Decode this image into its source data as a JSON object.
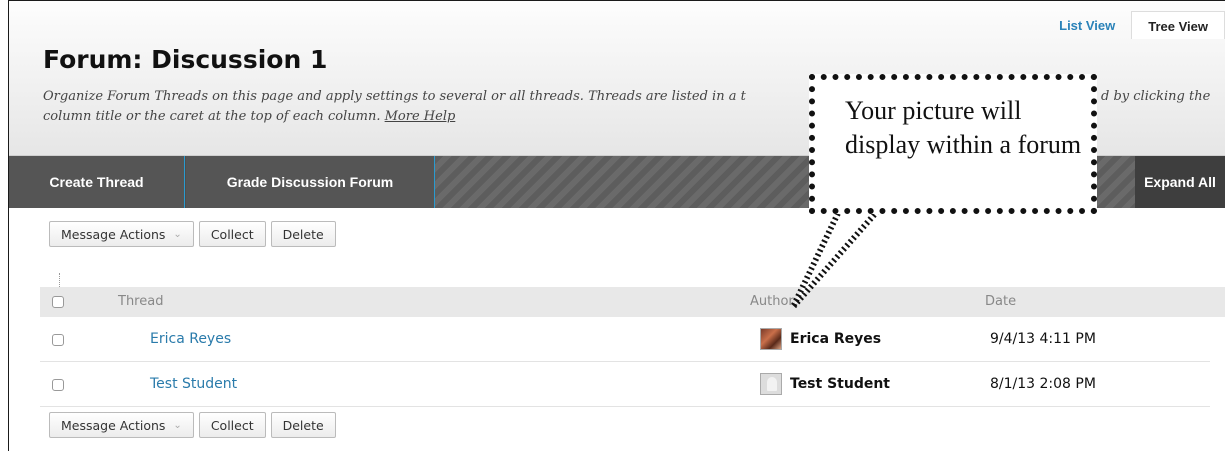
{
  "view_tabs": [
    "List View",
    "Tree View"
  ],
  "title": "Forum: Discussion 1",
  "description": "Organize Forum Threads on this page and apply settings to several or all threads. Threads are listed in a t",
  "description_tail": "d by clicking the",
  "description_line2": "column title or the caret at the top of each column.",
  "more_help": "More Help",
  "actionbar": {
    "create": "Create Thread",
    "grade": "Grade Discussion Forum",
    "expand": "Expand All"
  },
  "buttons": {
    "message_actions": "Message Actions",
    "collect": "Collect",
    "delete": "Delete"
  },
  "columns": {
    "thread": "Thread",
    "author": "Author",
    "date": "Date"
  },
  "rows": [
    {
      "thread": "Erica Reyes",
      "author": "Erica Reyes",
      "date": "9/4/13 4:11 PM"
    },
    {
      "thread": "Test Student",
      "author": "Test Student",
      "date": "8/1/13 2:08 PM"
    }
  ],
  "callout": "Your picture will display within a forum"
}
